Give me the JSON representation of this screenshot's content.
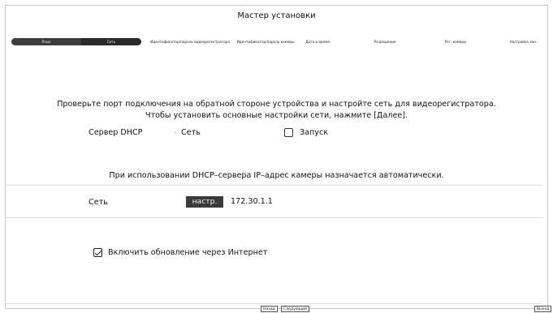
{
  "window": {
    "title": "Мастер установки"
  },
  "steps": [
    {
      "label": "Язык",
      "state": "done"
    },
    {
      "label": "Сеть",
      "state": "current"
    },
    {
      "label": "Идентификатор/пароль видеорегистратора",
      "state": "pending"
    },
    {
      "label": "Идентификатор/пароль камеры",
      "state": "pending"
    },
    {
      "label": "Дата и время",
      "state": "pending"
    },
    {
      "label": "Разрешение",
      "state": "pending"
    },
    {
      "label": "Рег. камеры",
      "state": "pending"
    },
    {
      "label": "Настройка кан.",
      "state": "pending"
    }
  ],
  "main": {
    "instruction_line1": "Проверьте порт подключения на обратной стороне устройства и настройте сеть для видеорегистратора.",
    "instruction_line2": "Чтобы установить основные настройки сети, нажмите [Далее].",
    "dhcp": {
      "label": "Сервер DHCP",
      "network_label": "Сеть",
      "start_label": "Запуск",
      "start_checked": false
    },
    "dhcp_note": "При использовании DHCP–сервера IP–адрес камеры назначается автоматически.",
    "network": {
      "label": "Сеть",
      "setup_button": "настр.",
      "ip": "172.30.1.1"
    },
    "internet_update": {
      "label": "Включить обновление через Интернет",
      "checked": true
    }
  },
  "footer": {
    "back_button": "Назад",
    "next_button": "Следующий",
    "exit_button": "Выход"
  },
  "colors": {
    "step_active": "#2a2a2a",
    "button_dark": "#3a3a3a",
    "separator": "#dcdcdc"
  }
}
